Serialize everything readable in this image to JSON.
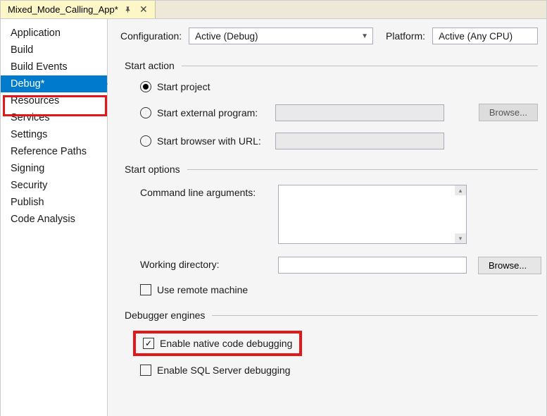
{
  "tab": {
    "title": "Mixed_Mode_Calling_App*"
  },
  "sidebar": {
    "items": [
      {
        "label": "Application"
      },
      {
        "label": "Build"
      },
      {
        "label": "Build Events"
      },
      {
        "label": "Debug*",
        "selected": true
      },
      {
        "label": "Resources"
      },
      {
        "label": "Services"
      },
      {
        "label": "Settings"
      },
      {
        "label": "Reference Paths"
      },
      {
        "label": "Signing"
      },
      {
        "label": "Security"
      },
      {
        "label": "Publish"
      },
      {
        "label": "Code Analysis"
      }
    ]
  },
  "config": {
    "configuration_label": "Configuration:",
    "configuration_value": "Active (Debug)",
    "platform_label": "Platform:",
    "platform_value": "Active (Any CPU)"
  },
  "start_action": {
    "title": "Start action",
    "opt1": "Start project",
    "opt2": "Start external program:",
    "opt3": "Start browser with URL:",
    "browse": "Browse..."
  },
  "start_options": {
    "title": "Start options",
    "cli_label": "Command line arguments:",
    "wd_label": "Working directory:",
    "browse": "Browse...",
    "remote_label": "Use remote machine"
  },
  "debugger": {
    "title": "Debugger engines",
    "native_label": "Enable native code debugging",
    "sql_label": "Enable SQL Server debugging"
  }
}
